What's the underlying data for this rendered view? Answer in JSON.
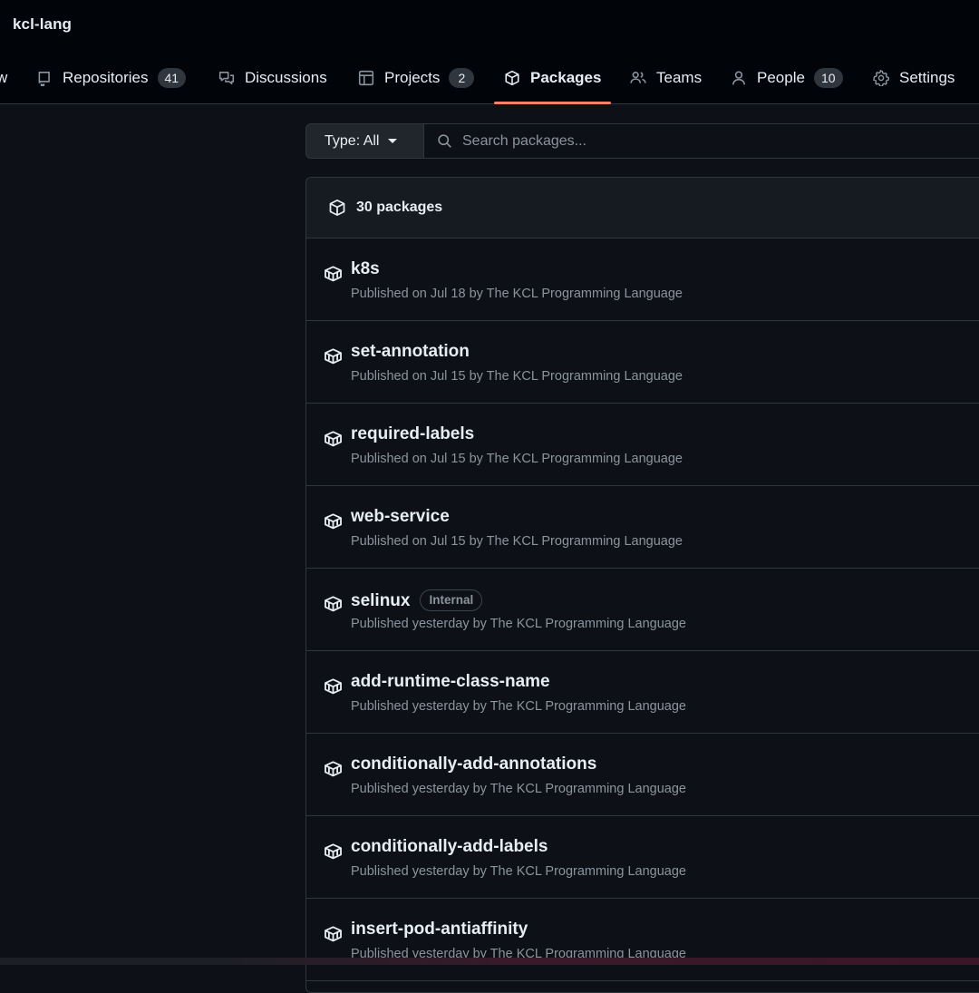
{
  "org": {
    "name": "kcl-lang"
  },
  "nav": {
    "overview_partial": "w",
    "repositories": {
      "label": "Repositories",
      "count": "41"
    },
    "discussions": {
      "label": "Discussions"
    },
    "projects": {
      "label": "Projects",
      "count": "2"
    },
    "packages": {
      "label": "Packages"
    },
    "teams": {
      "label": "Teams"
    },
    "people": {
      "label": "People",
      "count": "10"
    },
    "settings": {
      "label": "Settings"
    }
  },
  "filter": {
    "type_label": "Type: All",
    "search_placeholder": "Search packages..."
  },
  "list": {
    "count_label": "30 packages",
    "packages": [
      {
        "name": "k8s",
        "meta": "Published on Jul 18 by The KCL Programming Language"
      },
      {
        "name": "set-annotation",
        "meta": "Published on Jul 15 by The KCL Programming Language"
      },
      {
        "name": "required-labels",
        "meta": "Published on Jul 15 by The KCL Programming Language"
      },
      {
        "name": "web-service",
        "meta": "Published on Jul 15 by The KCL Programming Language"
      },
      {
        "name": "selinux",
        "badge": "Internal",
        "meta": "Published yesterday by The KCL Programming Language"
      },
      {
        "name": "add-runtime-class-name",
        "meta": "Published yesterday by The KCL Programming Language"
      },
      {
        "name": "conditionally-add-annotations",
        "meta": "Published yesterday by The KCL Programming Language"
      },
      {
        "name": "conditionally-add-labels",
        "meta": "Published yesterday by The KCL Programming Language"
      },
      {
        "name": "insert-pod-antiaffinity",
        "meta": "Published yesterday by The KCL Programming Language"
      }
    ]
  },
  "colors": {
    "accent_underline": "#f78166",
    "background": "#0d1117",
    "muted_text": "#8b949e"
  }
}
